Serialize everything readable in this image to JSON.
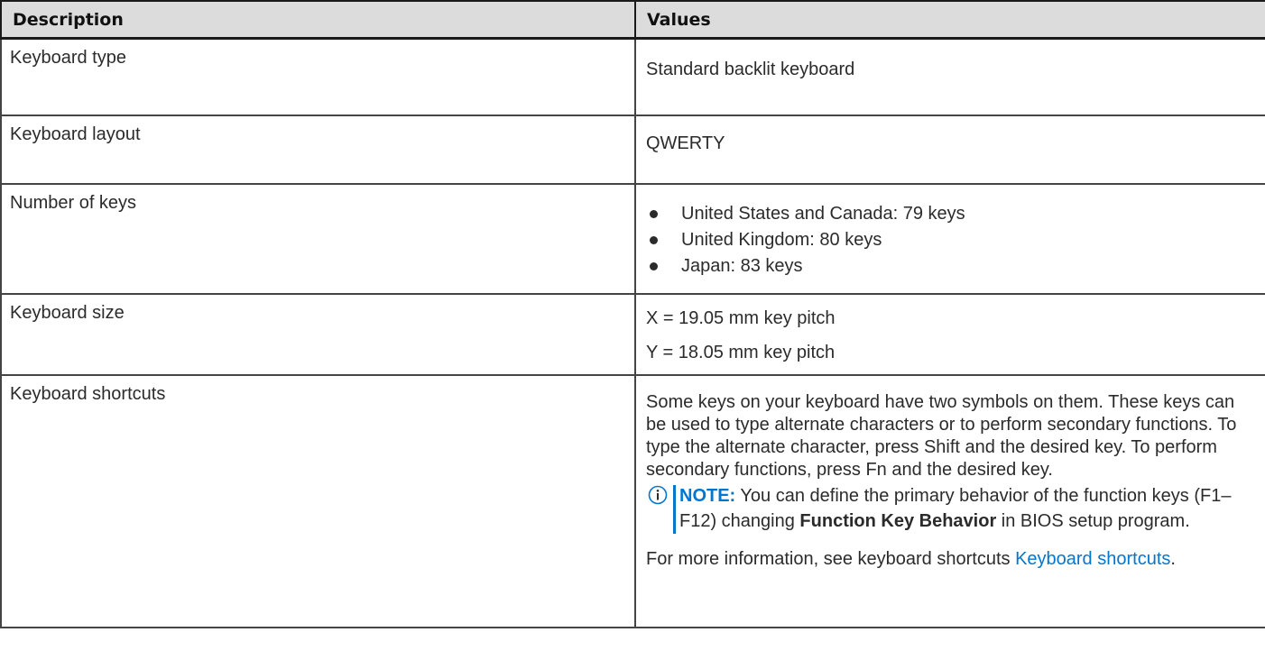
{
  "table": {
    "headers": {
      "description": "Description",
      "values": "Values"
    },
    "keyboard_type": {
      "label": "Keyboard type",
      "value": "Standard backlit keyboard"
    },
    "keyboard_layout": {
      "label": "Keyboard layout",
      "value": "QWERTY"
    },
    "number_of_keys": {
      "label": "Number of keys",
      "items": [
        "United States and Canada: 79 keys",
        "United Kingdom: 80 keys",
        "Japan: 83 keys"
      ]
    },
    "keyboard_size": {
      "label": "Keyboard size",
      "x": "X = 19.05 mm key pitch",
      "y": "Y = 18.05 mm key pitch"
    },
    "keyboard_shortcuts": {
      "label": "Keyboard shortcuts",
      "paragraph": "Some keys on your keyboard have two symbols on them. These keys can be used to type alternate characters or to perform secondary functions. To type the alternate character, press Shift and the desired key. To perform secondary functions, press Fn and the desired key.",
      "note": {
        "icon": "info-circle-icon",
        "label": "NOTE:",
        "text_before": " You can define the primary behavior of the function keys (F1–F12) changing ",
        "bold_text": "Function Key Behavior",
        "text_after": " in BIOS setup program."
      },
      "more_info": {
        "text": "For more information, see keyboard shortcuts ",
        "link": "Keyboard shortcuts",
        "end": "."
      }
    }
  },
  "colors": {
    "link": "#0076ce",
    "header_bg": "#dcdcdc",
    "border": "#444444"
  }
}
